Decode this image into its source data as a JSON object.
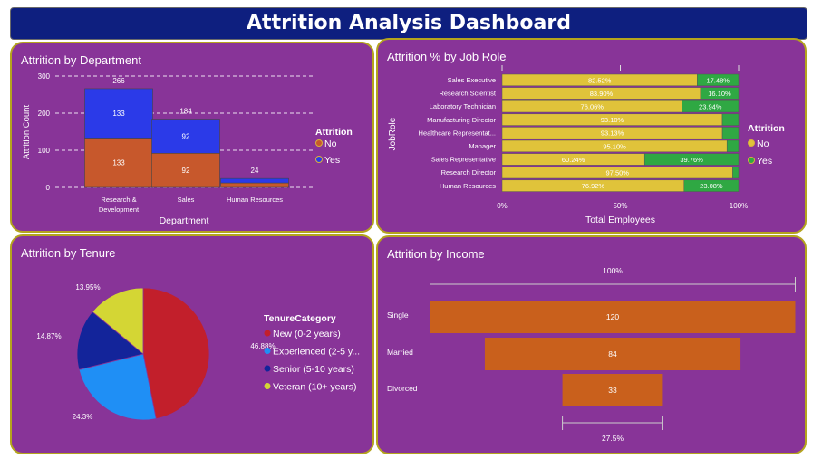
{
  "title": "Attrition Analysis Dashboard",
  "colors": {
    "panel": "#883498",
    "border": "#b4a41e",
    "no": "#c7582c",
    "yes": "#2b3ae8",
    "role_no": "#e0c33a",
    "role_yes": "#2fa843",
    "tenure": [
      "#c21f2b",
      "#1f8ff5",
      "#13249a",
      "#d4d634"
    ],
    "income": "#c9601c"
  },
  "chart_data": [
    {
      "type": "bar",
      "title": "Attrition by Department",
      "xlabel": "Department",
      "ylabel": "Attrition Count",
      "ylim": [
        0,
        300
      ],
      "yticks": [
        "0",
        "100",
        "200",
        "300"
      ],
      "categories": [
        "Research &",
        "Sales",
        "Human Resources"
      ],
      "category_lines2": [
        "Development",
        "",
        ""
      ],
      "series": [
        {
          "name": "No",
          "values": [
            133,
            92,
            12
          ]
        },
        {
          "name": "Yes",
          "values": [
            133,
            92,
            12
          ]
        }
      ],
      "totals": [
        266,
        184,
        24
      ],
      "inner_labels_no": [
        "133",
        "92",
        ""
      ],
      "inner_labels_yes": [
        "133",
        "92",
        ""
      ],
      "legend_title": "Attrition",
      "legend": [
        "No",
        "Yes"
      ],
      "grid": true
    },
    {
      "type": "bar",
      "title": "Attrition % by Job Role",
      "xlabel": "Total Employees",
      "ylabel": "JobRole",
      "xticks": [
        "0%",
        "50%",
        "100%"
      ],
      "categories": [
        "Sales Executive",
        "Research Scientist",
        "Laboratory Technician",
        "Manufacturing Director",
        "Healthcare Representat...",
        "Manager",
        "Sales Representative",
        "Research Director",
        "Human Resources"
      ],
      "series": [
        {
          "name": "No",
          "values": [
            82.52,
            83.9,
            76.06,
            93.1,
            93.13,
            95.1,
            60.24,
            97.5,
            76.92
          ]
        },
        {
          "name": "Yes",
          "values": [
            17.48,
            16.1,
            23.94,
            6.9,
            6.87,
            4.9,
            39.76,
            2.5,
            23.08
          ]
        }
      ],
      "labels_no": [
        "82.52%",
        "83.90%",
        "76.06%",
        "93.10%",
        "93.13%",
        "95.10%",
        "60.24%",
        "97.50%",
        "76.92%"
      ],
      "labels_yes": [
        "17.48%",
        "16.10%",
        "23.94%",
        "",
        "",
        "",
        "39.76%",
        "",
        "23.08%"
      ],
      "legend_title": "Attrition",
      "legend": [
        "No",
        "Yes"
      ]
    },
    {
      "type": "pie",
      "title": "Attrition by Tenure",
      "legend_title": "TenureCategory",
      "categories": [
        "New (0-2 years)",
        "Experienced (2-5 y...",
        "Senior (5-10 years)",
        "Veteran (10+ years)"
      ],
      "values": [
        46.88,
        24.3,
        14.87,
        13.95
      ],
      "labels": [
        "46.88%",
        "24.3%",
        "14.87%",
        "13.95%"
      ]
    },
    {
      "type": "bar",
      "title": "Attrition by Income",
      "categories": [
        "Single",
        "Married",
        "Divorced"
      ],
      "values": [
        120,
        84,
        33
      ],
      "top_label": "100%",
      "bottom_label": "27.5%"
    }
  ]
}
